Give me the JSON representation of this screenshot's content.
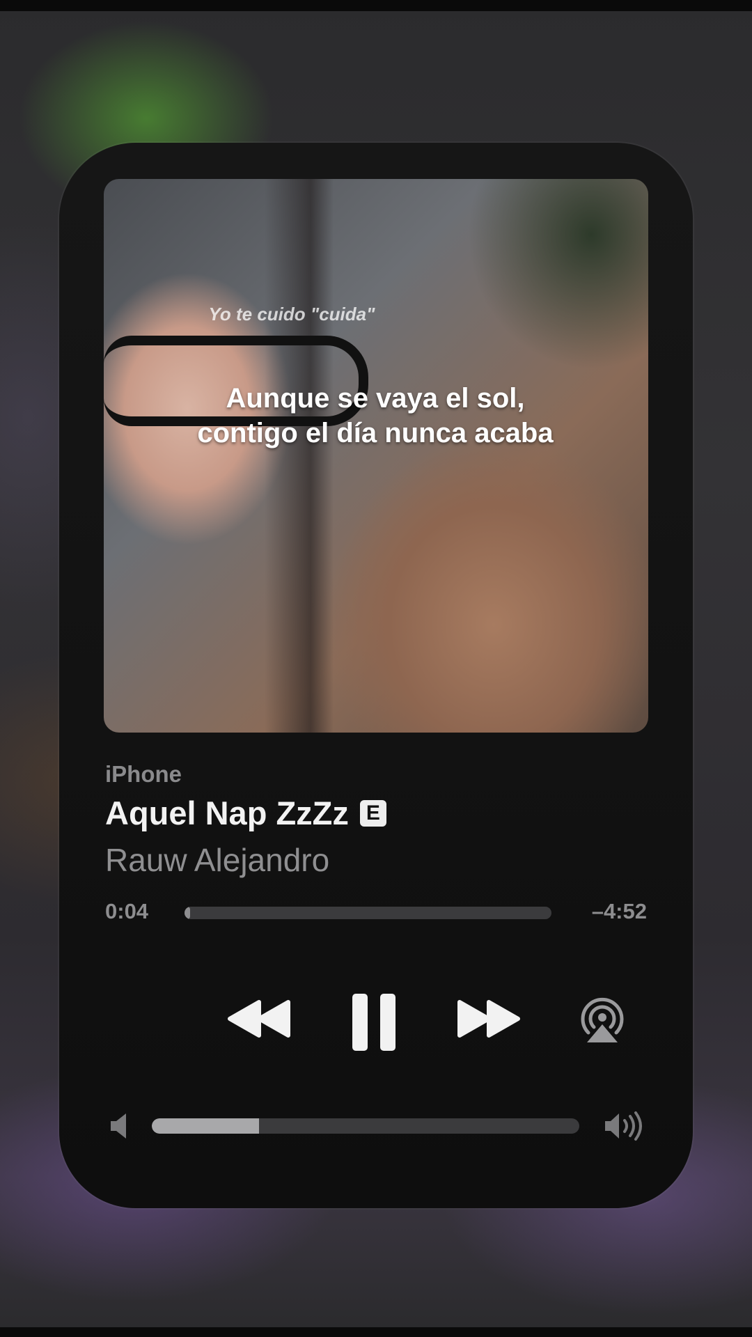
{
  "player": {
    "device": "iPhone",
    "title": "Aquel Nap ZzZz",
    "explicit_badge": "E",
    "artist": "Rauw Alejandro",
    "elapsed": "0:04",
    "remaining": "–4:52",
    "progress_fraction": 0.014,
    "volume_fraction": 0.25
  },
  "artwork": {
    "caption_top": "Yo te cuido \"cuida\"",
    "caption": "Aunque se vaya el sol, contigo el día nunca acaba"
  },
  "icons": {
    "rewind": "rewind-icon",
    "pause": "pause-icon",
    "forward": "fast-forward-icon",
    "airplay": "airplay-icon",
    "volume_low": "speaker-low-icon",
    "volume_high": "speaker-high-icon"
  },
  "colors": {
    "card_bg": "#141414",
    "primary_text": "#f2f2f2",
    "secondary_text": "#8f8f91",
    "track": "#3b3b3d"
  }
}
